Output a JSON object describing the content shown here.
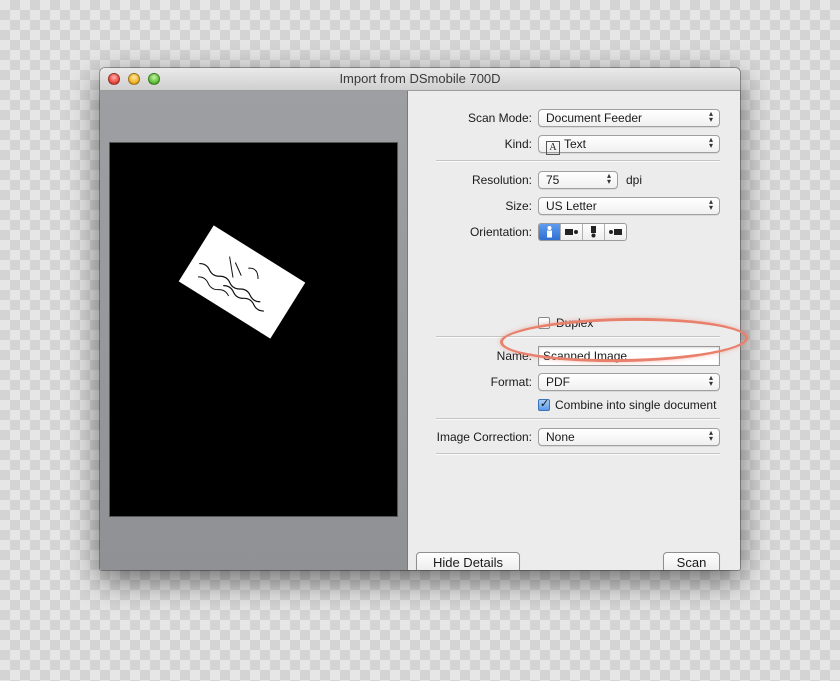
{
  "window": {
    "title": "Import from DSmobile 700D"
  },
  "preview": {
    "icon": "scanned-card-preview"
  },
  "settings": {
    "scan_mode": {
      "label": "Scan Mode:",
      "value": "Document Feeder"
    },
    "kind": {
      "label": "Kind:",
      "icon_glyph": "A",
      "value": "Text"
    },
    "resolution": {
      "label": "Resolution:",
      "value": "75",
      "unit": "dpi"
    },
    "size": {
      "label": "Size:",
      "value": "US Letter"
    },
    "orientation": {
      "label": "Orientation:",
      "selected_index": 0,
      "options": [
        "portrait-upright-icon",
        "rotate-right-icon",
        "upside-down-icon",
        "rotate-left-icon"
      ]
    },
    "duplex": {
      "label": "Duplex",
      "checked": false
    },
    "name": {
      "label": "Name:",
      "value": "Scanned Image"
    },
    "format": {
      "label": "Format:",
      "value": "PDF"
    },
    "combine": {
      "label": "Combine into single document",
      "checked": true
    },
    "image_correction": {
      "label": "Image Correction:",
      "value": "None"
    }
  },
  "buttons": {
    "hide_details": "Hide Details",
    "scan": "Scan"
  },
  "colors": {
    "highlight": "#e8806c",
    "accent": "#2f6fd2"
  }
}
